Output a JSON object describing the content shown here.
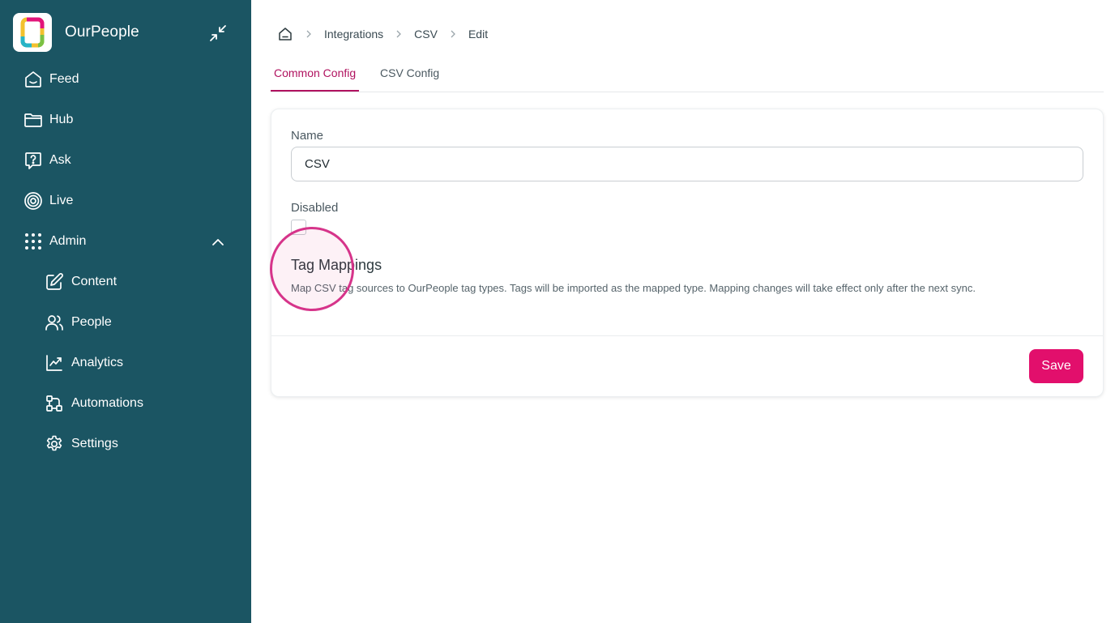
{
  "app": {
    "name": "OurPeople",
    "colors": {
      "sidebar": "#1b5563",
      "accent": "#b0125f",
      "primary_button": "#e20f6c"
    }
  },
  "sidebar": {
    "collapse_icon": "collapse-arrows-icon",
    "items": [
      {
        "label": "Feed",
        "icon": "home-icon"
      },
      {
        "label": "Hub",
        "icon": "folder-icon"
      },
      {
        "label": "Ask",
        "icon": "question-icon"
      },
      {
        "label": "Live",
        "icon": "target-icon"
      },
      {
        "label": "Admin",
        "icon": "grid-dots-icon",
        "expanded": true
      }
    ],
    "admin_items": [
      {
        "label": "Content",
        "icon": "edit-icon"
      },
      {
        "label": "People",
        "icon": "users-icon"
      },
      {
        "label": "Analytics",
        "icon": "chart-line-icon"
      },
      {
        "label": "Automations",
        "icon": "workflow-icon"
      },
      {
        "label": "Settings",
        "icon": "gear-icon"
      }
    ]
  },
  "breadcrumb": {
    "home_icon": "home-icon",
    "items": [
      "Integrations",
      "CSV",
      "Edit"
    ]
  },
  "tabs": [
    {
      "label": "Common Config",
      "active": true
    },
    {
      "label": "CSV Config",
      "active": false
    }
  ],
  "form": {
    "name_label": "Name",
    "name_value": "CSV",
    "disabled_label": "Disabled",
    "disabled_checked": false,
    "section_title": "Tag Mappings",
    "section_description": "Map CSV tag sources to OurPeople tag types. Tags will be imported as the mapped type. Mapping changes will take effect only after the next sync.",
    "save_label": "Save"
  }
}
